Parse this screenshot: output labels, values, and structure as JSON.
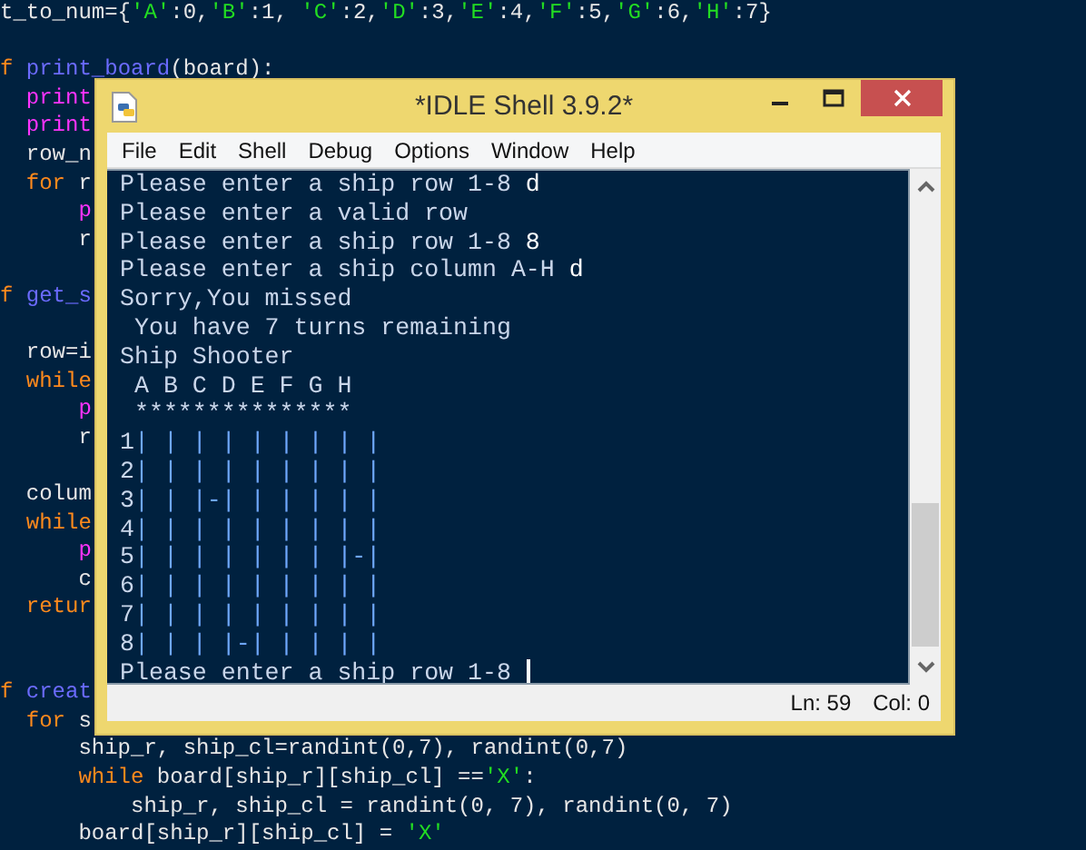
{
  "editor": {
    "lines": [
      {
        "kind": "code",
        "segments": [
          {
            "text": "t_to_num={",
            "kind": "plain"
          },
          {
            "text": "'A'",
            "kind": "string"
          },
          {
            "text": ":0,",
            "kind": "plain"
          },
          {
            "text": "'B'",
            "kind": "string"
          },
          {
            "text": ":1, ",
            "kind": "plain"
          },
          {
            "text": "'C'",
            "kind": "string"
          },
          {
            "text": ":2,",
            "kind": "plain"
          },
          {
            "text": "'D'",
            "kind": "string"
          },
          {
            "text": ":3,",
            "kind": "plain"
          },
          {
            "text": "'E'",
            "kind": "string"
          },
          {
            "text": ":4,",
            "kind": "plain"
          },
          {
            "text": "'F'",
            "kind": "string"
          },
          {
            "text": ":5,",
            "kind": "plain"
          },
          {
            "text": "'G'",
            "kind": "string"
          },
          {
            "text": ":6,",
            "kind": "plain"
          },
          {
            "text": "'H'",
            "kind": "string"
          },
          {
            "text": ":7}",
            "kind": "plain"
          }
        ]
      },
      {
        "kind": "blank"
      },
      {
        "kind": "code",
        "segments": [
          {
            "text": "f",
            "kind": "keyword"
          },
          {
            "text": " print_board",
            "kind": "defname"
          },
          {
            "text": "(board):",
            "kind": "plain"
          }
        ]
      },
      {
        "kind": "code",
        "segments": [
          {
            "text": "  print",
            "kind": "builtin"
          }
        ]
      },
      {
        "kind": "code",
        "segments": [
          {
            "text": "  print",
            "kind": "builtin"
          }
        ]
      },
      {
        "kind": "code",
        "segments": [
          {
            "text": "  row_n",
            "kind": "plain"
          }
        ]
      },
      {
        "kind": "code",
        "segments": [
          {
            "text": "  for",
            "kind": "keyword"
          },
          {
            "text": " r",
            "kind": "plain"
          }
        ]
      },
      {
        "kind": "code",
        "segments": [
          {
            "text": "      p",
            "kind": "builtin"
          }
        ]
      },
      {
        "kind": "code",
        "segments": [
          {
            "text": "      r",
            "kind": "plain"
          }
        ]
      },
      {
        "kind": "blank"
      },
      {
        "kind": "code",
        "segments": [
          {
            "text": "f",
            "kind": "keyword"
          },
          {
            "text": " get_s",
            "kind": "defname"
          }
        ]
      },
      {
        "kind": "blank"
      },
      {
        "kind": "code",
        "segments": [
          {
            "text": "  row=i",
            "kind": "plain"
          }
        ]
      },
      {
        "kind": "code",
        "segments": [
          {
            "text": "  while",
            "kind": "keyword"
          }
        ]
      },
      {
        "kind": "code",
        "segments": [
          {
            "text": "      p",
            "kind": "builtin"
          }
        ]
      },
      {
        "kind": "code",
        "segments": [
          {
            "text": "      r",
            "kind": "plain"
          }
        ]
      },
      {
        "kind": "blank"
      },
      {
        "kind": "code",
        "segments": [
          {
            "text": "  colum",
            "kind": "plain"
          }
        ]
      },
      {
        "kind": "code",
        "segments": [
          {
            "text": "  while",
            "kind": "keyword"
          }
        ]
      },
      {
        "kind": "code",
        "segments": [
          {
            "text": "      p",
            "kind": "builtin"
          }
        ]
      },
      {
        "kind": "code",
        "segments": [
          {
            "text": "      c",
            "kind": "plain"
          }
        ]
      },
      {
        "kind": "code",
        "segments": [
          {
            "text": "  retur",
            "kind": "keyword"
          }
        ]
      },
      {
        "kind": "blank"
      },
      {
        "kind": "blank"
      },
      {
        "kind": "code",
        "segments": [
          {
            "text": "f",
            "kind": "keyword"
          },
          {
            "text": " creat",
            "kind": "defname"
          }
        ]
      },
      {
        "kind": "code",
        "segments": [
          {
            "text": "  for",
            "kind": "keyword"
          },
          {
            "text": " s",
            "kind": "plain"
          }
        ]
      },
      {
        "kind": "code",
        "segments": [
          {
            "text": "      ship_r, ship_cl=randint(0,7), randint(0,7)",
            "kind": "plain"
          }
        ]
      },
      {
        "kind": "code",
        "segments": [
          {
            "text": "      while",
            "kind": "keyword"
          },
          {
            "text": " board[ship_r][ship_cl] ==",
            "kind": "plain"
          },
          {
            "text": "'X'",
            "kind": "string"
          },
          {
            "text": ":",
            "kind": "plain"
          }
        ]
      },
      {
        "kind": "code",
        "segments": [
          {
            "text": "          ship_r, ship_cl = randint(0, 7), randint(0, 7)",
            "kind": "plain"
          }
        ]
      },
      {
        "kind": "code",
        "segments": [
          {
            "text": "      board[ship_r][ship_cl] = ",
            "kind": "plain"
          },
          {
            "text": "'X'",
            "kind": "string"
          }
        ]
      }
    ]
  },
  "window": {
    "title": "*IDLE Shell 3.9.2*",
    "menu": [
      "File",
      "Edit",
      "Shell",
      "Debug",
      "Options",
      "Window",
      "Help"
    ],
    "shell": [
      {
        "segments": [
          {
            "text": "Please enter a ship row 1-8",
            "kind": "output"
          },
          {
            "text": " d",
            "kind": "input"
          }
        ]
      },
      {
        "segments": [
          {
            "text": "Please enter a valid row",
            "kind": "output"
          }
        ]
      },
      {
        "segments": [
          {
            "text": "Please enter a ship row 1-8",
            "kind": "output"
          },
          {
            "text": " 8",
            "kind": "input"
          }
        ]
      },
      {
        "segments": [
          {
            "text": "Please enter a ship column A-H",
            "kind": "output"
          },
          {
            "text": " d",
            "kind": "input"
          }
        ]
      },
      {
        "segments": [
          {
            "text": "Sorry,You missed",
            "kind": "output"
          }
        ]
      },
      {
        "segments": [
          {
            "text": " You have 7 turns remaining",
            "kind": "output"
          }
        ]
      },
      {
        "segments": [
          {
            "text": "Ship Shooter",
            "kind": "output"
          }
        ]
      },
      {
        "segments": [
          {
            "text": " A B C D E F G H",
            "kind": "output"
          }
        ]
      },
      {
        "segments": [
          {
            "text": " ***************",
            "kind": "output"
          }
        ]
      },
      {
        "segments": [
          {
            "text": "1",
            "kind": "output"
          },
          {
            "text": "| | | | | | | | |",
            "kind": "board"
          }
        ]
      },
      {
        "segments": [
          {
            "text": "2",
            "kind": "output"
          },
          {
            "text": "| | | | | | | | |",
            "kind": "board"
          }
        ]
      },
      {
        "segments": [
          {
            "text": "3",
            "kind": "output"
          },
          {
            "text": "| | |-| | | | | |",
            "kind": "board"
          }
        ]
      },
      {
        "segments": [
          {
            "text": "4",
            "kind": "output"
          },
          {
            "text": "| | | | | | | | |",
            "kind": "board"
          }
        ]
      },
      {
        "segments": [
          {
            "text": "5",
            "kind": "output"
          },
          {
            "text": "| | | | | | | |-|",
            "kind": "board"
          }
        ]
      },
      {
        "segments": [
          {
            "text": "6",
            "kind": "output"
          },
          {
            "text": "| | | | | | | | |",
            "kind": "board"
          }
        ]
      },
      {
        "segments": [
          {
            "text": "7",
            "kind": "output"
          },
          {
            "text": "| | | | | | | | |",
            "kind": "board"
          }
        ]
      },
      {
        "segments": [
          {
            "text": "8",
            "kind": "output"
          },
          {
            "text": "| | | |-| | | | |",
            "kind": "board"
          }
        ]
      },
      {
        "segments": [
          {
            "text": "Please enter a ship row 1-8",
            "kind": "output"
          }
        ]
      }
    ],
    "status": {
      "line": "Ln: 59",
      "column": "Col: 0"
    }
  }
}
